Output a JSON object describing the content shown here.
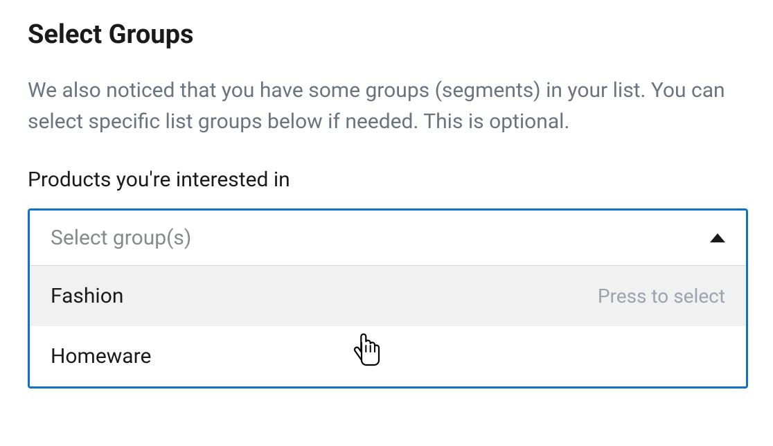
{
  "heading": "Select Groups",
  "description": "We also noticed that you have some groups (segments) in your list. You can select specific list groups below if needed. This is optional.",
  "field_label": "Products you're interested in",
  "select": {
    "placeholder": "Select group(s)",
    "hint": "Press to select",
    "options": [
      {
        "label": "Fashion",
        "hovered": true
      },
      {
        "label": "Homeware",
        "hovered": false
      }
    ]
  }
}
